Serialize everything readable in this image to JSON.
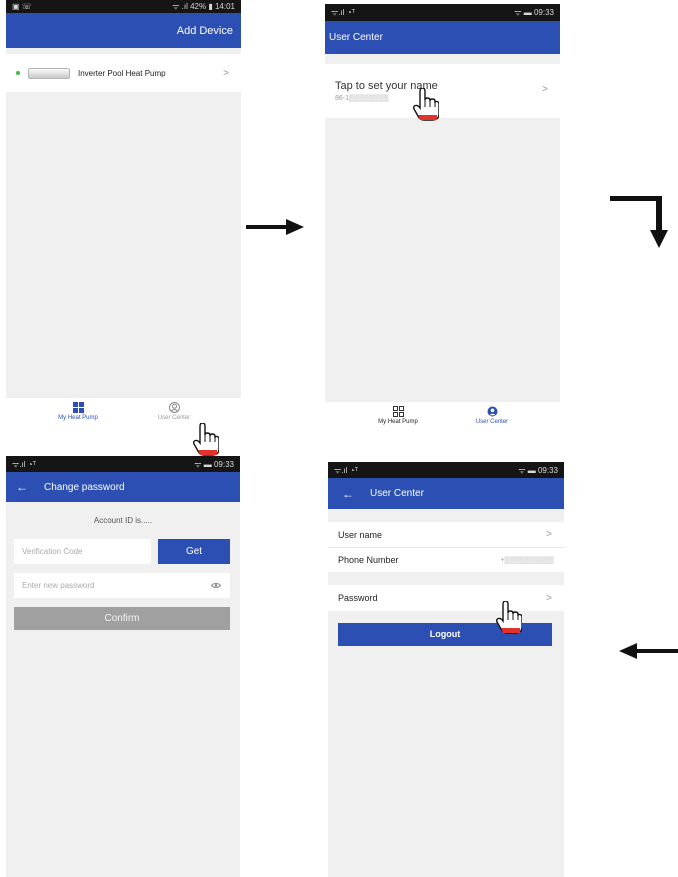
{
  "screen1": {
    "status_left": "▣ ☏",
    "status_right": "ᯤ .ıl 42% ▮ 14:01",
    "add_device_label": "Add Device",
    "device_name": "Inverter Pool Heat Pump",
    "chevron": ">",
    "tab_home_label": "My Heat Pump",
    "tab_user_label": "User Center"
  },
  "screen2": {
    "status_left": "ᯤ.ıl ◔ᵀ",
    "status_right": "ᯤ ▬ 09:33",
    "title": "User Center",
    "name_prompt": "Tap to set your name",
    "phone_masked": "86-1▒▒▒▒▒▒▒▒",
    "chevron": ">",
    "tab_home_label": "My Heat Pump",
    "tab_user_label": "User Center"
  },
  "screen3": {
    "status_left": "ᯤ.ıl ◔ᵀ",
    "status_right": "ᯤ ▬ 09:33",
    "back": "←",
    "title": "Change password",
    "account_id": "Account ID is.....",
    "verification_placeholder": "Verification Code",
    "get_label": "Get",
    "new_password_placeholder": "Enter new password",
    "confirm_label": "Confirm"
  },
  "screen4": {
    "status_left": "ᯤ.ıl ◔ᵀ",
    "status_right": "ᯤ ▬ 09:33",
    "back": "←",
    "title": "User Center",
    "username_label": "User name",
    "phone_label": "Phone Number",
    "phone_value_masked": "+▒▒▒▒▒▒▒▒▒▒",
    "password_label": "Password",
    "chevron": ">",
    "logout_label": "Logout"
  },
  "colors": {
    "app_bar": "#2c4fb4",
    "status_bar": "#151515",
    "background": "#f0f0f0",
    "disabled_button": "#a0a0a0",
    "status_dot": "#3bbf3b",
    "hand_cuff": "#e3322b"
  },
  "icons": {
    "tab_home": "grid-icon",
    "tab_user": "user-icon",
    "password_visibility": "eye-icon",
    "pointer": "hand-pointer-icon",
    "flow": "arrow-icon"
  }
}
